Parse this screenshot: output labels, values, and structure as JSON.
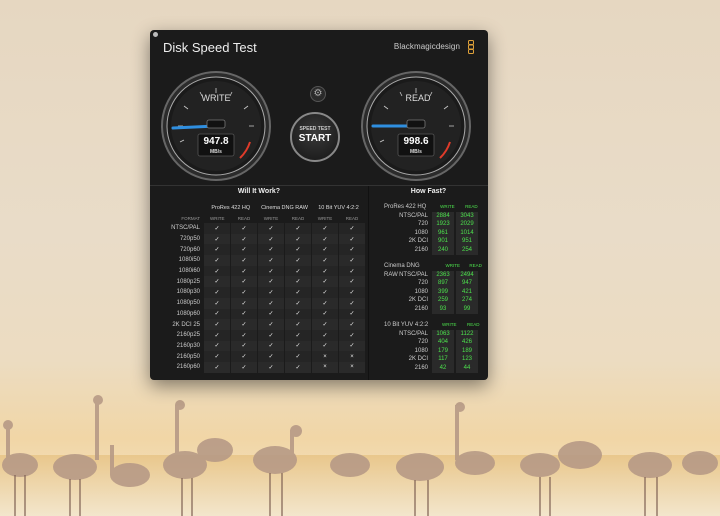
{
  "app": {
    "title": "Disk Speed Test",
    "brand": "Blackmagicdesign"
  },
  "gauges": {
    "write": {
      "label": "WRITE",
      "value": "947.8",
      "unit": "MB/s"
    },
    "read": {
      "label": "READ",
      "value": "998.6",
      "unit": "MB/s"
    }
  },
  "start": {
    "small": "SPEED TEST",
    "big": "START"
  },
  "settings_icon": "gear-icon",
  "will_it_work": {
    "title": "Will It Work?",
    "format_label": "FORMAT",
    "groups": [
      "ProRes 422 HQ",
      "Cinema DNG RAW",
      "10 Bit YUV 4:2:2"
    ],
    "sub": [
      "WRITE",
      "READ"
    ],
    "rows": [
      {
        "f": "NTSC/PAL",
        "v": [
          "✓",
          "✓",
          "✓",
          "✓",
          "✓",
          "✓"
        ]
      },
      {
        "f": "720p50",
        "v": [
          "✓",
          "✓",
          "✓",
          "✓",
          "✓",
          "✓"
        ]
      },
      {
        "f": "720p60",
        "v": [
          "✓",
          "✓",
          "✓",
          "✓",
          "✓",
          "✓"
        ]
      },
      {
        "f": "1080i50",
        "v": [
          "✓",
          "✓",
          "✓",
          "✓",
          "✓",
          "✓"
        ]
      },
      {
        "f": "1080i60",
        "v": [
          "✓",
          "✓",
          "✓",
          "✓",
          "✓",
          "✓"
        ]
      },
      {
        "f": "1080p25",
        "v": [
          "✓",
          "✓",
          "✓",
          "✓",
          "✓",
          "✓"
        ]
      },
      {
        "f": "1080p30",
        "v": [
          "✓",
          "✓",
          "✓",
          "✓",
          "✓",
          "✓"
        ]
      },
      {
        "f": "1080p50",
        "v": [
          "✓",
          "✓",
          "✓",
          "✓",
          "✓",
          "✓"
        ]
      },
      {
        "f": "1080p60",
        "v": [
          "✓",
          "✓",
          "✓",
          "✓",
          "✓",
          "✓"
        ]
      },
      {
        "f": "2K DCI 25",
        "v": [
          "✓",
          "✓",
          "✓",
          "✓",
          "✓",
          "✓"
        ]
      },
      {
        "f": "2160p25",
        "v": [
          "✓",
          "✓",
          "✓",
          "✓",
          "✓",
          "✓"
        ]
      },
      {
        "f": "2160p30",
        "v": [
          "✓",
          "✓",
          "✓",
          "✓",
          "✓",
          "✓"
        ]
      },
      {
        "f": "2160p50",
        "v": [
          "✓",
          "✓",
          "✓",
          "✓",
          "×",
          "×"
        ]
      },
      {
        "f": "2160p60",
        "v": [
          "✓",
          "✓",
          "✓",
          "✓",
          "×",
          "×"
        ]
      }
    ]
  },
  "how_fast": {
    "title": "How Fast?",
    "sub": [
      "WRITE",
      "READ"
    ],
    "groups": [
      {
        "name": "ProRes 422 HQ",
        "rows": [
          {
            "f": "NTSC/PAL",
            "w": "2884",
            "r": "3043"
          },
          {
            "f": "720",
            "w": "1923",
            "r": "2029"
          },
          {
            "f": "1080",
            "w": "961",
            "r": "1014"
          },
          {
            "f": "2K DCI",
            "w": "901",
            "r": "951"
          },
          {
            "f": "2160",
            "w": "240",
            "r": "254"
          }
        ]
      },
      {
        "name": "Cinema DNG RAW",
        "rows": [
          {
            "f": "NTSC/PAL",
            "w": "2363",
            "r": "2494"
          },
          {
            "f": "720",
            "w": "897",
            "r": "947"
          },
          {
            "f": "1080",
            "w": "399",
            "r": "421"
          },
          {
            "f": "2K DCI",
            "w": "259",
            "r": "274"
          },
          {
            "f": "2160",
            "w": "93",
            "r": "99"
          }
        ]
      },
      {
        "name": "10 Bit YUV 4:2:2",
        "rows": [
          {
            "f": "NTSC/PAL",
            "w": "1063",
            "r": "1122"
          },
          {
            "f": "720",
            "w": "404",
            "r": "426"
          },
          {
            "f": "1080",
            "w": "179",
            "r": "189"
          },
          {
            "f": "2K DCI",
            "w": "117",
            "r": "123"
          },
          {
            "f": "2160",
            "w": "42",
            "r": "44"
          }
        ]
      }
    ]
  },
  "colors": {
    "needle": "#2f8fe0",
    "ok": "#4ce14c",
    "red_zone": "#e03b2a"
  }
}
